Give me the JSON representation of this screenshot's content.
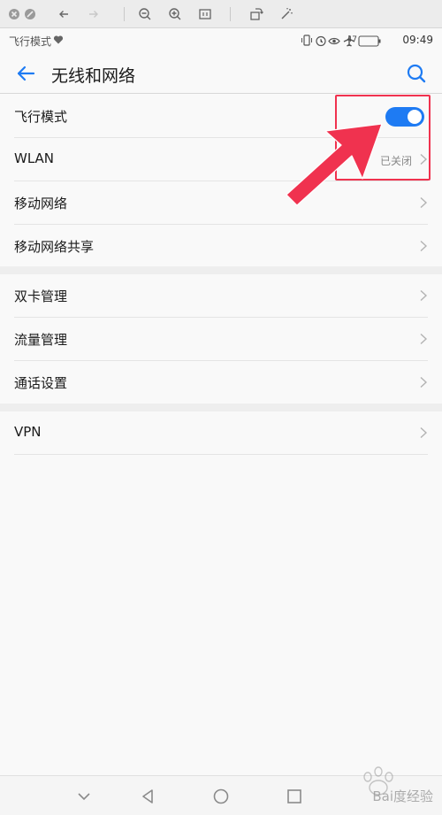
{
  "status_bar": {
    "left_label": "飞行模式",
    "battery": "47",
    "time": "09:49"
  },
  "header": {
    "title": "无线和网络"
  },
  "groups": [
    {
      "items": [
        {
          "label": "飞行模式",
          "control": "toggle",
          "toggle_on": true
        },
        {
          "label": "WLAN",
          "value": "已关闭"
        },
        {
          "label": "移动网络"
        },
        {
          "label": "移动网络共享"
        }
      ]
    },
    {
      "items": [
        {
          "label": "双卡管理"
        },
        {
          "label": "流量管理"
        },
        {
          "label": "通话设置"
        }
      ]
    },
    {
      "items": [
        {
          "label": "VPN"
        }
      ]
    }
  ],
  "watermark": {
    "text": "Bai度经验"
  },
  "colors": {
    "accent": "#1e7bf3",
    "annotation": "#f0324f",
    "background": "#f9f9f9"
  },
  "icons": {
    "back": "arrow-left-icon",
    "search": "search-icon"
  }
}
